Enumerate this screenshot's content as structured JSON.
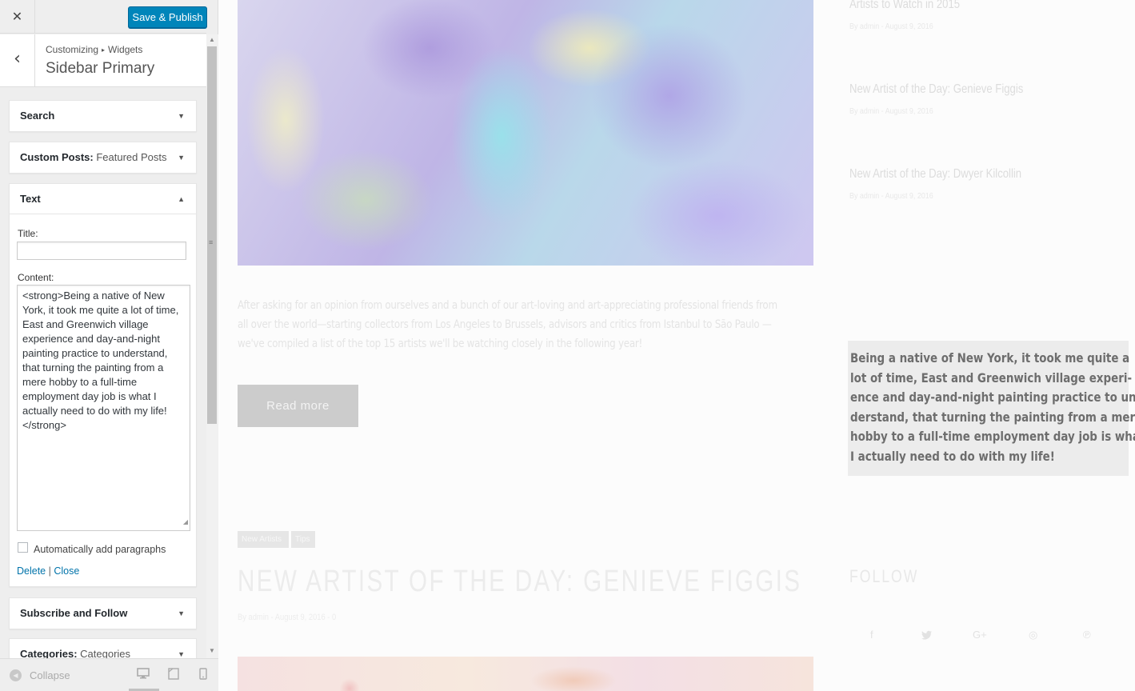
{
  "customizer": {
    "close_label": "✕",
    "save_label": "Save & Publish",
    "back_label": "‹",
    "breadcrumb": {
      "root": "Customizing",
      "separator": "▸",
      "current": "Widgets"
    },
    "section_title": "Sidebar Primary",
    "widgets": [
      {
        "title": "Search",
        "subtitle": "",
        "arrow": "▼"
      },
      {
        "title": "Custom Posts:",
        "subtitle": "Featured Posts",
        "arrow": "▼"
      },
      {
        "title": "Text",
        "subtitle": "",
        "arrow": "▲"
      },
      {
        "title": "Subscribe and Follow",
        "subtitle": "",
        "arrow": "▼"
      },
      {
        "title": "Categories:",
        "subtitle": "Categories",
        "arrow": "▼"
      }
    ],
    "text_widget": {
      "title_label": "Title:",
      "title_value": "",
      "content_label": "Content:",
      "content_value": "<strong>Being a native of New York, it took me quite a lot of time, East and Greenwich village experience and day-and-night painting practice to understand, that turning the painting from a mere hobby to a full-time employment day job is what I actually need to do with my life!</strong>",
      "auto_paragraph_label": "Automatically add paragraphs",
      "auto_paragraph_checked": false,
      "delete_label": "Delete",
      "link_separator": "|",
      "close_label": "Close"
    },
    "footer": {
      "collapse_label": "Collapse",
      "devices": [
        "desktop",
        "tablet",
        "mobile"
      ],
      "active_device": "desktop"
    }
  },
  "preview": {
    "excerpt_lines": [
      "After asking for an opinion from ourselves and a bunch of our art-loving and art-appreciating professional friends from",
      "all over the world—starting collectors from Los Angeles to Brussels, advisors and critics from Istanbul to São Paulo —",
      "we've compiled a list of the top 15 artists we'll be watching closely in the following year!"
    ],
    "read_more_label": "Read more",
    "recent_posts": [
      {
        "title": "Artists to Watch in 2015",
        "meta": "By admin - August 9, 2016"
      },
      {
        "title": "New Artist of the Day: Genieve Figgis",
        "meta": "By admin - August 9, 2016"
      },
      {
        "title": "New Artist of the Day: Dwyer Kilcollin",
        "meta": "By admin - August 9, 2016"
      }
    ],
    "text_widget_lines": [
      "Being a native of New York, it took me quite a",
      "lot of time, East and Greenwich village experi-",
      "ence and day-and-night painting practice to un-",
      "derstand, that turning the painting from a mere",
      "hobby to a full-time employment day job is what",
      "I actually need to do with my life!"
    ],
    "tags": [
      "New Artists",
      "Tips"
    ],
    "post_title": "NEW ARTIST OF THE DAY: GENIEVE FIGGIS",
    "post_meta": "By admin - August 9, 2016 - 0",
    "follow_title": "FOLLOW",
    "social_icons": [
      {
        "name": "facebook-icon",
        "glyph": "f"
      },
      {
        "name": "twitter-icon",
        "glyph": "🐦"
      },
      {
        "name": "google-plus-icon",
        "glyph": "G+"
      },
      {
        "name": "instagram-icon",
        "glyph": "◎"
      },
      {
        "name": "pinterest-icon",
        "glyph": "℗"
      }
    ]
  },
  "colors": {
    "accent": "#0085ba",
    "link": "#0073aa",
    "sidebar_bg": "#eeeeee"
  }
}
